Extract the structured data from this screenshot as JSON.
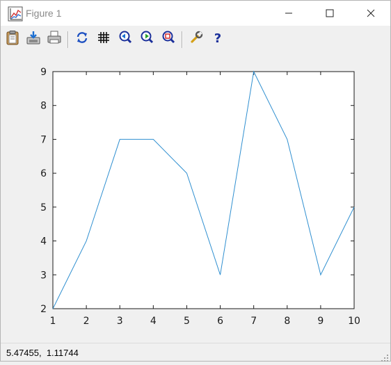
{
  "window": {
    "title": "Figure 1",
    "icon": "plot-app-icon",
    "controls": [
      "minimize-icon",
      "maximize-icon",
      "close-icon"
    ]
  },
  "toolbar": {
    "buttons": [
      {
        "name": "copy-button",
        "icon": "clipboard-icon"
      },
      {
        "name": "save-button",
        "icon": "save-disk-icon"
      },
      {
        "name": "print-button",
        "icon": "printer-icon"
      },
      {
        "name": "replot-button",
        "icon": "refresh-icon"
      },
      {
        "name": "grid-button",
        "icon": "grid-icon"
      },
      {
        "name": "zoom-previous-button",
        "icon": "zoom-previous-icon"
      },
      {
        "name": "zoom-next-button",
        "icon": "zoom-next-icon"
      },
      {
        "name": "autoscale-button",
        "icon": "autoscale-icon"
      },
      {
        "name": "options-button",
        "icon": "wrench-icon"
      },
      {
        "name": "help-button",
        "icon": "question-icon"
      }
    ]
  },
  "chart_data": {
    "type": "line",
    "x": [
      1,
      2,
      3,
      4,
      5,
      6,
      7,
      8,
      9,
      10
    ],
    "series": [
      {
        "values": [
          2,
          4,
          7,
          7,
          6,
          3,
          9,
          7,
          3,
          5
        ],
        "color": "#2f8fd0"
      }
    ],
    "xlim": [
      1,
      10
    ],
    "ylim": [
      2,
      9
    ],
    "xticks": [
      "1",
      "2",
      "3",
      "4",
      "5",
      "6",
      "7",
      "8",
      "9",
      "10"
    ],
    "yticks": [
      "2",
      "3",
      "4",
      "5",
      "6",
      "7",
      "8",
      "9"
    ],
    "title": "",
    "xlabel": "",
    "ylabel": "",
    "grid": false
  },
  "status": {
    "coordinates": "5.47455,  1.11744"
  }
}
